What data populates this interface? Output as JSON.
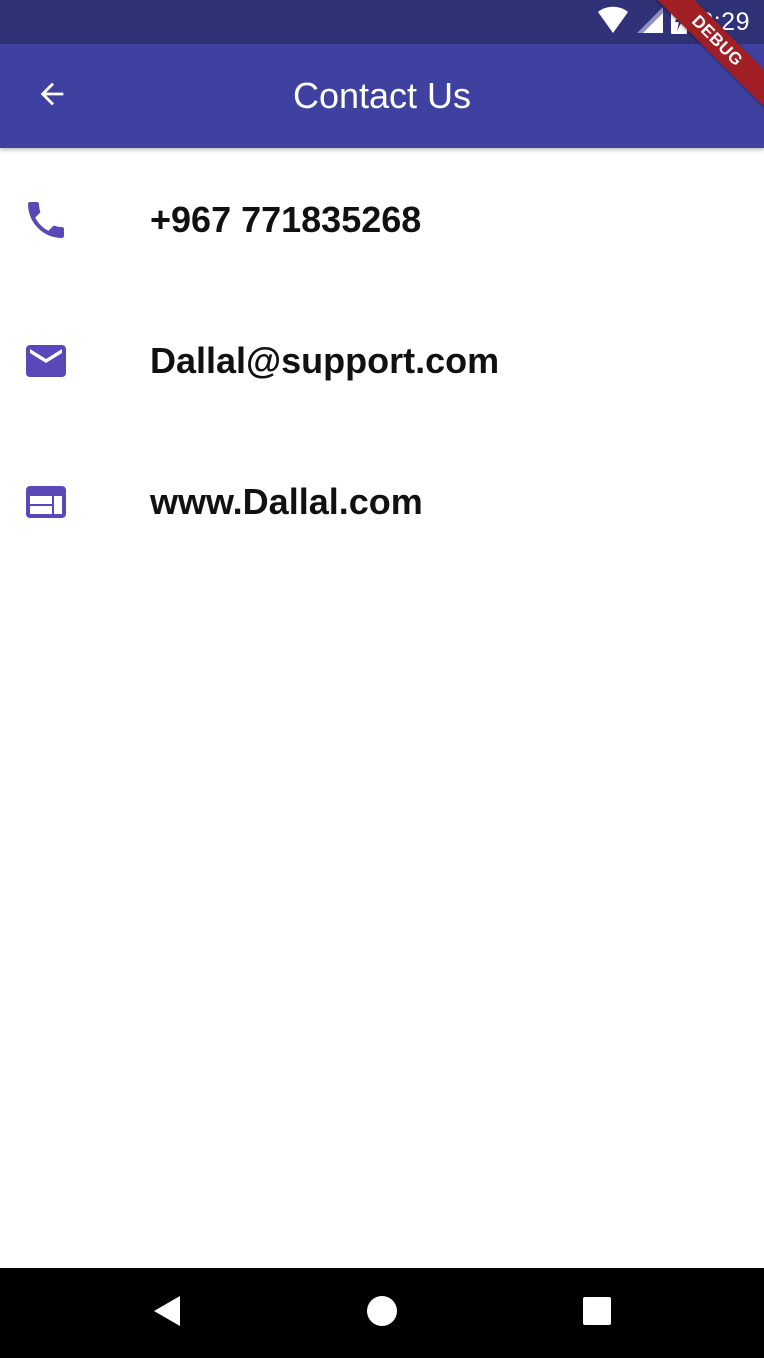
{
  "status_bar": {
    "time": "2:29",
    "icons": [
      "wifi-icon",
      "cell-signal-icon",
      "battery-charging-icon"
    ]
  },
  "debug_banner": {
    "label": "DEBUG"
  },
  "app_bar": {
    "title": "Contact Us",
    "back_icon": "arrow-back-icon"
  },
  "contacts": [
    {
      "icon": "phone-icon",
      "text": "+967 771835268"
    },
    {
      "icon": "email-icon",
      "text": "Dallal@support.com"
    },
    {
      "icon": "web-icon",
      "text": "www.Dallal.com"
    }
  ],
  "nav_bar": {
    "buttons": [
      "back-triangle-icon",
      "home-circle-icon",
      "recents-square-icon"
    ]
  },
  "colors": {
    "status_bar": "#303278",
    "app_bar": "#3f41a0",
    "accent_icon": "#5a48b8",
    "debug_ribbon": "#a01f25",
    "nav_bar": "#000000"
  }
}
